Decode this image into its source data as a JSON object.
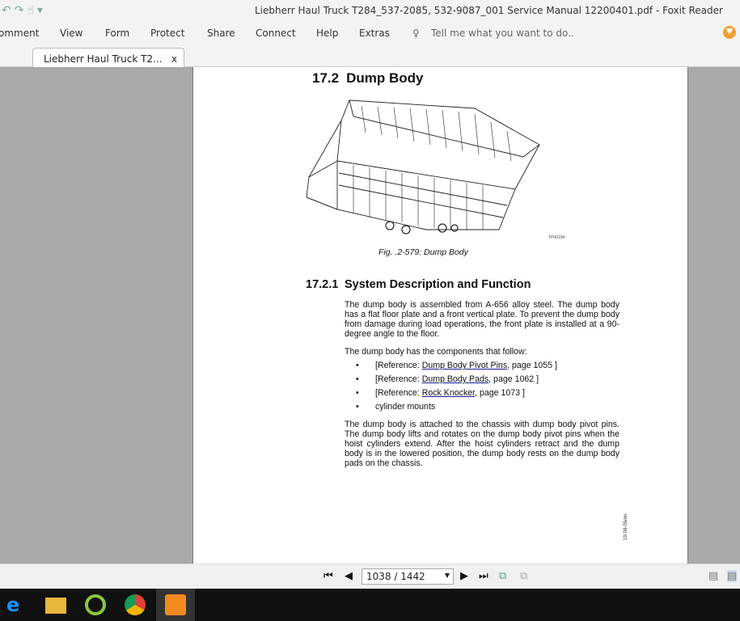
{
  "window": {
    "title": "Liebherr Haul Truck T284_537-2085, 532-9087_001 Service Manual 12200401.pdf - Foxit Reader"
  },
  "menu": [
    "omment",
    "View",
    "Form",
    "Protect",
    "Share",
    "Connect",
    "Help",
    "Extras"
  ],
  "tell_me": "Tell me what you want to do..",
  "tab": {
    "label": "Liebherr Haul Truck T2...",
    "close": "x"
  },
  "doc": {
    "section_num": "17.2",
    "section_title": "Dump Body",
    "fig_code": "TP00194",
    "caption": "Fig. .2-579: Dump Body",
    "sub_num": "17.2.1",
    "sub_title": "System Description and Function",
    "p1": "The dump body is assembled from A-656 alloy steel. The dump body has a flat floor plate and a front vertical plate. To prevent the dump body from damage during load operations, the front plate is installed at a 90-degree angle to the floor.",
    "p2": "The dump body has the components that follow:",
    "bullets": [
      {
        "pre": "[Reference: ",
        "link": "Dump Body Pivot Pins",
        "post": ", page   1055 ]"
      },
      {
        "pre": "[Reference: ",
        "link": "Dump Body Pads",
        "post": ", page   1062 ]"
      },
      {
        "pre": "[Reference: ",
        "link": "Rock Knocker",
        "post": ", page   1073 ]"
      },
      {
        "pre": "cylinder mounts",
        "link": "",
        "post": ""
      }
    ],
    "p3": "The dump body is attached to the chassis with dump body pivot pins. The dump body lifts and rotates on the dump body pivot pins when the hoist cylinders extend. After the hoist cylinders retract and the dump body is in the lowered position, the dump body rests on the dump body pads on the chassis.",
    "side_code": "19-08-05/en"
  },
  "status": {
    "page_value": "1038 / 1442"
  }
}
